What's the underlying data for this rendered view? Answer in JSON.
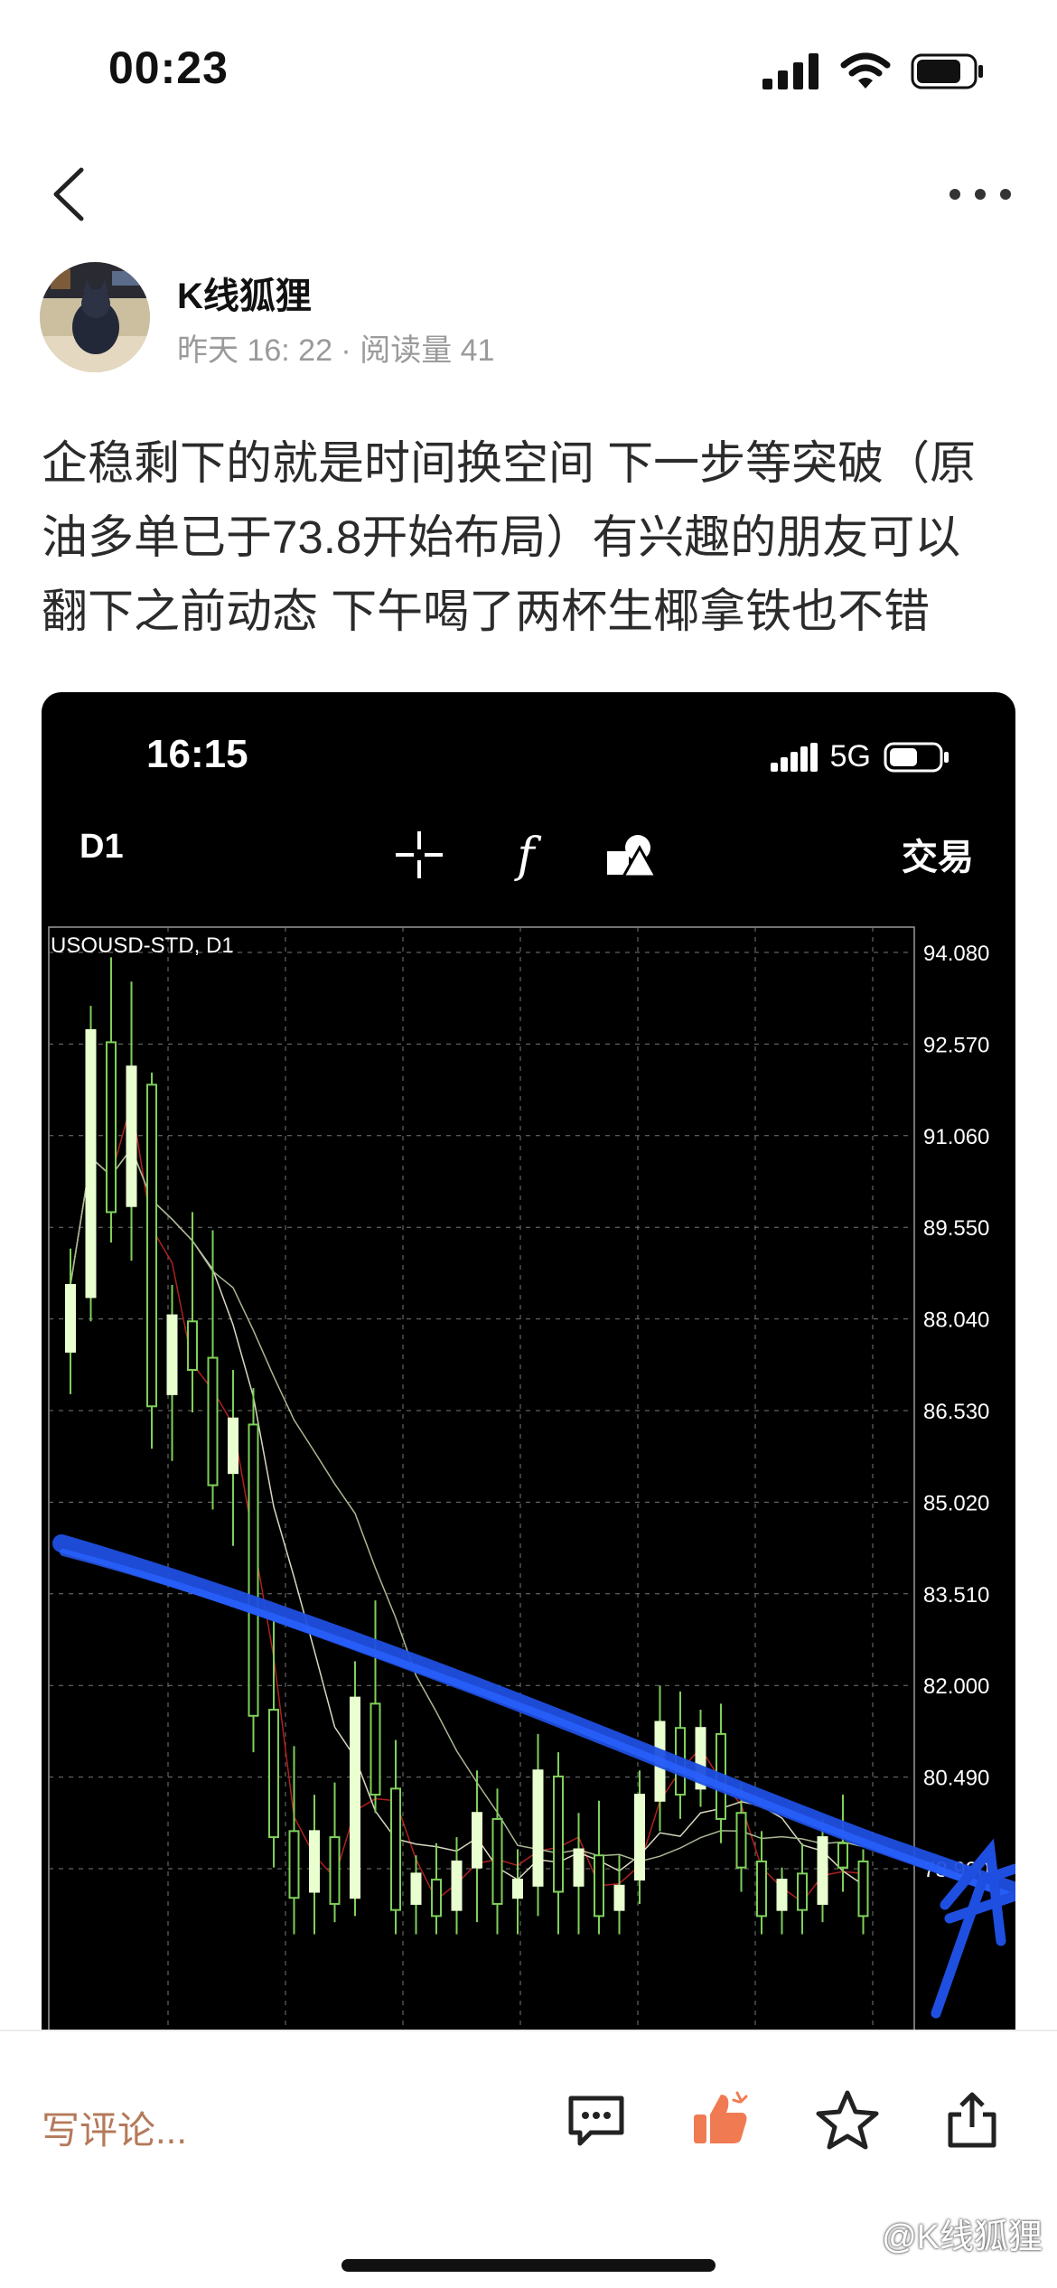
{
  "status_bar": {
    "time": "00:23"
  },
  "author": {
    "name": "K线狐狸",
    "meta": "昨天 16: 22 · 阅读量 41"
  },
  "post": {
    "lines": [
      "企稳剩下的就是时间换空间 下一步等突破（原",
      "油多单已于73.8开始布局）有兴趣的朋友可以",
      "翻下之前动态 下午喝了两杯生椰拿铁也不错"
    ]
  },
  "embedded_screenshot": {
    "time": "16:15",
    "network": "5G",
    "period": "D1",
    "trade_label": "交易",
    "chart_label": "USOUSD-STD, D1",
    "price_ticks": [
      "94.080",
      "92.570",
      "91.060",
      "89.550",
      "88.040",
      "86.530",
      "85.020",
      "83.510",
      "82.000",
      "80.490",
      "78.980"
    ]
  },
  "bottom_bar": {
    "comment_placeholder": "写评论...",
    "watermark": "@K线狐狸"
  },
  "chart_data": {
    "type": "candlestick",
    "title": "USOUSD-STD, D1",
    "y_ticks": [
      94.08,
      92.57,
      91.06,
      89.55,
      88.04,
      86.53,
      85.02,
      83.51,
      82.0,
      80.49,
      78.98
    ],
    "ylim": [
      77.9,
      94.5
    ],
    "candles": [
      {
        "o": 87.5,
        "h": 89.2,
        "l": 86.8,
        "c": 88.6
      },
      {
        "o": 88.4,
        "h": 93.2,
        "l": 88.0,
        "c": 92.8
      },
      {
        "o": 92.6,
        "h": 94.0,
        "l": 89.3,
        "c": 89.8
      },
      {
        "o": 89.9,
        "h": 93.6,
        "l": 89.0,
        "c": 92.2
      },
      {
        "o": 91.9,
        "h": 92.1,
        "l": 85.9,
        "c": 86.6
      },
      {
        "o": 86.8,
        "h": 88.6,
        "l": 85.7,
        "c": 88.1
      },
      {
        "o": 88.0,
        "h": 89.8,
        "l": 86.5,
        "c": 87.2
      },
      {
        "o": 87.4,
        "h": 89.5,
        "l": 84.9,
        "c": 85.3
      },
      {
        "o": 85.5,
        "h": 87.2,
        "l": 84.3,
        "c": 86.4
      },
      {
        "o": 86.3,
        "h": 86.9,
        "l": 80.9,
        "c": 81.5
      },
      {
        "o": 81.6,
        "h": 83.1,
        "l": 79.0,
        "c": 79.5
      },
      {
        "o": 79.6,
        "h": 81.0,
        "l": 77.9,
        "c": 78.5
      },
      {
        "o": 78.6,
        "h": 80.2,
        "l": 77.9,
        "c": 79.6
      },
      {
        "o": 79.5,
        "h": 80.4,
        "l": 78.1,
        "c": 78.4
      },
      {
        "o": 78.5,
        "h": 82.4,
        "l": 78.2,
        "c": 81.8
      },
      {
        "o": 81.7,
        "h": 83.4,
        "l": 79.9,
        "c": 80.2
      },
      {
        "o": 80.3,
        "h": 81.1,
        "l": 77.9,
        "c": 78.3
      },
      {
        "o": 78.4,
        "h": 79.2,
        "l": 77.9,
        "c": 78.9
      },
      {
        "o": 78.8,
        "h": 79.4,
        "l": 77.9,
        "c": 78.2
      },
      {
        "o": 78.3,
        "h": 79.5,
        "l": 77.9,
        "c": 79.1
      },
      {
        "o": 79.0,
        "h": 80.6,
        "l": 78.1,
        "c": 79.9
      },
      {
        "o": 79.8,
        "h": 80.3,
        "l": 77.9,
        "c": 78.4
      },
      {
        "o": 78.5,
        "h": 79.3,
        "l": 77.9,
        "c": 78.8
      },
      {
        "o": 78.7,
        "h": 81.2,
        "l": 78.2,
        "c": 80.6
      },
      {
        "o": 80.5,
        "h": 80.9,
        "l": 77.9,
        "c": 78.6
      },
      {
        "o": 78.7,
        "h": 79.9,
        "l": 77.9,
        "c": 79.3
      },
      {
        "o": 79.2,
        "h": 80.1,
        "l": 77.9,
        "c": 78.2
      },
      {
        "o": 78.3,
        "h": 79.2,
        "l": 77.9,
        "c": 78.7
      },
      {
        "o": 78.8,
        "h": 80.6,
        "l": 78.4,
        "c": 80.2
      },
      {
        "o": 80.1,
        "h": 82.0,
        "l": 79.6,
        "c": 81.4
      },
      {
        "o": 81.3,
        "h": 81.9,
        "l": 79.8,
        "c": 80.2
      },
      {
        "o": 80.3,
        "h": 81.6,
        "l": 80.0,
        "c": 81.3
      },
      {
        "o": 81.2,
        "h": 81.7,
        "l": 79.4,
        "c": 79.8
      },
      {
        "o": 79.9,
        "h": 80.4,
        "l": 78.6,
        "c": 79.0
      },
      {
        "o": 79.1,
        "h": 79.6,
        "l": 77.9,
        "c": 78.2
      },
      {
        "o": 78.3,
        "h": 79.0,
        "l": 77.9,
        "c": 78.8
      },
      {
        "o": 78.9,
        "h": 79.4,
        "l": 77.9,
        "c": 78.3
      },
      {
        "o": 78.4,
        "h": 79.8,
        "l": 78.1,
        "c": 79.5
      },
      {
        "o": 79.4,
        "h": 80.2,
        "l": 78.6,
        "c": 79.0
      },
      {
        "o": 79.1,
        "h": 79.3,
        "l": 77.9,
        "c": 78.2
      }
    ],
    "annotation": "hand-drawn blue descending trendline"
  }
}
